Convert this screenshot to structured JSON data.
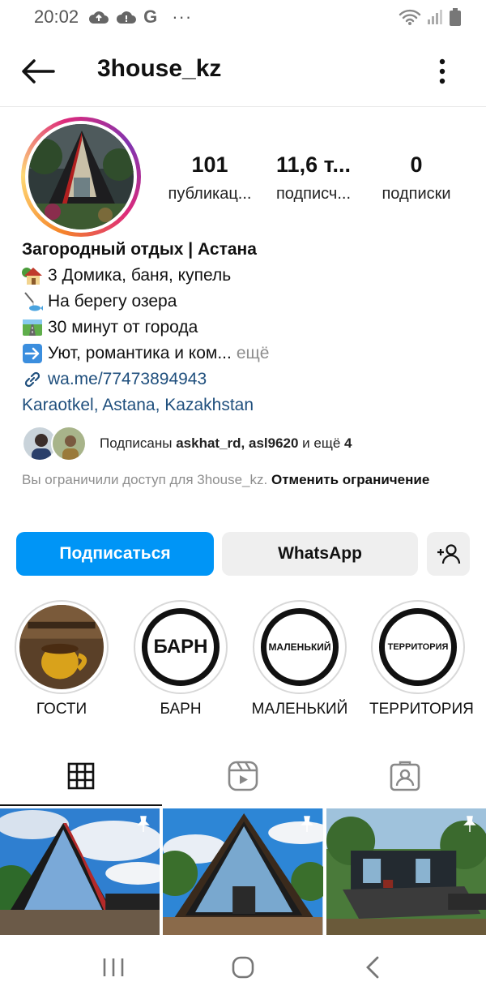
{
  "status_bar": {
    "time": "20:02",
    "extra": "G"
  },
  "header": {
    "username": "3house_kz"
  },
  "stats": [
    {
      "value": "101",
      "label": "публикац..."
    },
    {
      "value": "11,6 т...",
      "label": "подписч..."
    },
    {
      "value": "0",
      "label": "подписки"
    }
  ],
  "bio": {
    "name": "Загородный отдых | Астана",
    "line1": "3 Домика, баня, купель",
    "line2": "На берегу озера",
    "line3": "30 минут от города",
    "line4": "Уют, романтика и ком...",
    "line4_more": "ещё",
    "link": "wa.me/77473894943",
    "location": "Karaotkel, Astana, Kazakhstan"
  },
  "followed_by": {
    "prefix": "Подписаны",
    "names": "askhat_rd, asl9620",
    "and_more": "и ещё",
    "count": "4"
  },
  "restriction": {
    "text": "Вы ограничили доступ для 3house_kz.",
    "action": "Отменить ограничение"
  },
  "buttons": {
    "follow": "Подписаться",
    "whatsapp": "WhatsApp"
  },
  "highlights": [
    {
      "label": "ГОСТИ",
      "badge": ""
    },
    {
      "label": "БАРН",
      "badge": "БАРН"
    },
    {
      "label": "МАЛЕНЬКИЙ",
      "badge": "МАЛЕНЬКИЙ"
    },
    {
      "label": "ТЕРРИТОРИЯ",
      "badge": "ТЕРРИТОРИЯ"
    }
  ],
  "colors": {
    "accent": "#0095f6",
    "link": "#1f4f7d",
    "muted": "#8e8e8e"
  }
}
